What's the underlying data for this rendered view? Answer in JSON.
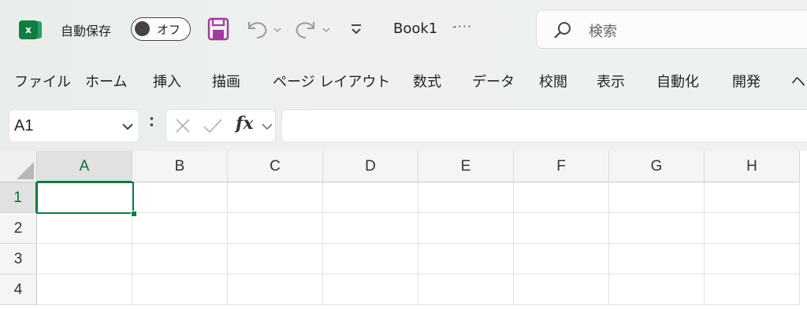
{
  "app": {
    "logo_text": "x",
    "autosave_label": "自動保存",
    "autosave_state": "オフ",
    "doc_title": "Book1",
    "doc_more": "-···",
    "accent": "#107c41"
  },
  "search": {
    "placeholder": "検索"
  },
  "ribbon": {
    "tabs": [
      "ファイル",
      "ホーム",
      "挿入",
      "描画",
      "ページ レイアウト",
      "数式",
      "データ",
      "校閲",
      "表示",
      "自動化",
      "開発",
      "ヘ"
    ]
  },
  "formula_bar": {
    "name_box": "A1",
    "fx_label": "fx",
    "formula": ""
  },
  "sheet": {
    "columns": [
      "A",
      "B",
      "C",
      "D",
      "E",
      "F",
      "G",
      "H"
    ],
    "rows": [
      "1",
      "2",
      "3",
      "4"
    ],
    "active_cell": "A1"
  },
  "icons": {
    "logo": "excel-logo-icon",
    "save": "save-icon",
    "undo": "undo-icon",
    "redo": "redo-icon",
    "customize": "customize-quick-access-icon",
    "search": "search-icon",
    "cancel": "cancel-icon",
    "enter": "check-icon",
    "dropdown": "chevron-down-icon"
  }
}
